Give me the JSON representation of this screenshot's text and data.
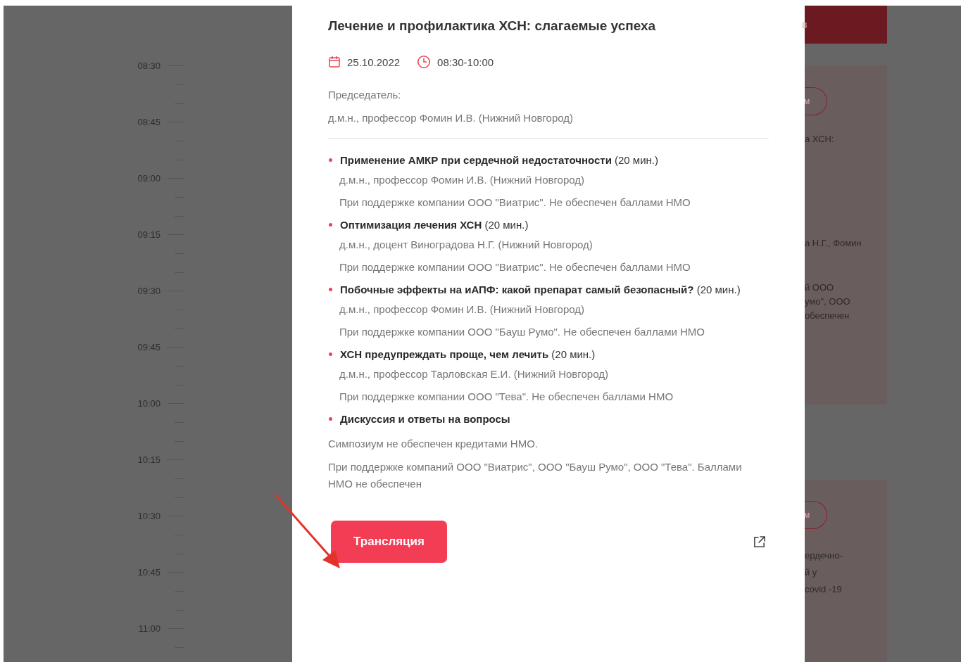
{
  "timeline": {
    "times": [
      "08:30",
      "08:45",
      "09:00",
      "09:15",
      "09:30",
      "09:45",
      "10:00",
      "10:15",
      "10:30",
      "10:45",
      "11:00"
    ]
  },
  "background_panel": {
    "header_fragment": "в",
    "cards": [
      {
        "button_fragment": "м",
        "paragraphs": [
          [
            "а ХСН:"
          ],
          [
            "а Н.Г., Фомин"
          ],
          [
            "й  ООО",
            "умо\", ООО",
            "обеспечен"
          ]
        ]
      },
      {
        "button_fragment": "м",
        "paragraphs": [
          [
            "ердечно-",
            "й у",
            "covid -19"
          ]
        ]
      }
    ]
  },
  "modal": {
    "title": "Лечение и профилактика ХСН: слагаемые успеха",
    "date": "25.10.2022",
    "time": "08:30-10:00",
    "chair_label": "Председатель:",
    "chair": "д.м.н., профессор Фомин И.В. (Нижний Новгород)",
    "talks": [
      {
        "title": "**Применение АМКР при сердечной недостаточности** (20 мин.)",
        "speaker": "д.м.н., профессор Фомин И.В. (Нижний Новгород)",
        "support": "При поддержке компании ООО \"Виатрис\". Не обеспечен баллами НМО"
      },
      {
        "title": "**Оптимизация лечения ХСН** (20 мин.)",
        "speaker": "д.м.н., доцент Виноградова Н.Г. (Нижний Новгород)",
        "support": "При поддержке компании ООО \"Виатрис\". Не обеспечен баллами НМО"
      },
      {
        "title": "**Побочные эффекты на иАПФ: какой препарат самый безопасный?** (20 мин.)",
        "speaker": "д.м.н., профессор Фомин И.В. (Нижний Новгород)",
        "support": "При поддержке компании ООО \"Бауш Румо\". Не обеспечен баллами НМО"
      },
      {
        "title": "**ХСН предупреждать проще, чем лечить** (20 мин.)",
        "speaker": "д.м.н., профессор Тарловская Е.И. (Нижний Новгород)",
        "support": "При поддержке компании ООО \"Тева\". Не обеспечен баллами НМО"
      },
      {
        "title": "**Дискуссия и ответы на вопросы**"
      }
    ],
    "notes": [
      "Симпозиум не обеспечен кредитами НМО.",
      "При поддержке компаний  ООО \"Виатрис\", ООО \"Бауш Румо\", ООО \"Тева\". Баллами НМО не обеспечен"
    ],
    "button": "Трансляция"
  }
}
